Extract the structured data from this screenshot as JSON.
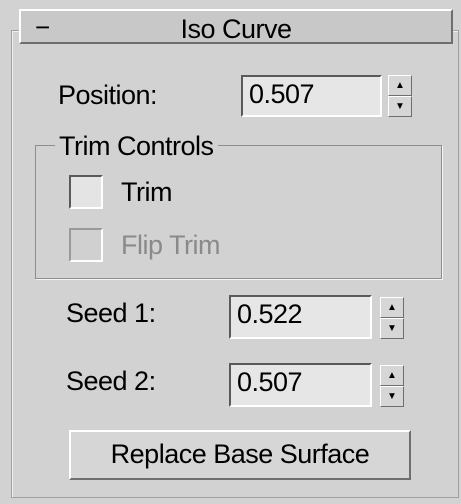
{
  "rollout": {
    "title": "Iso Curve",
    "collapse_glyph": "−",
    "collapse_icon": "minus-icon"
  },
  "position": {
    "label": "Position:",
    "value": "0.507"
  },
  "trim_controls": {
    "title": "Trim Controls",
    "trim": {
      "label": "Trim",
      "checked": false,
      "enabled": true
    },
    "flip_trim": {
      "label": "Flip Trim",
      "checked": false,
      "enabled": false
    }
  },
  "seed1": {
    "label": "Seed 1:",
    "value": "0.522"
  },
  "seed2": {
    "label": "Seed 2:",
    "value": "0.507"
  },
  "replace_button": {
    "label": "Replace Base Surface"
  },
  "spinner_icons": {
    "up": "▲",
    "down": "▼"
  },
  "colors": {
    "panel_bg": "#d2d2d2",
    "field_bg": "#e6e6e6",
    "disabled_text": "#8a8a8a"
  }
}
